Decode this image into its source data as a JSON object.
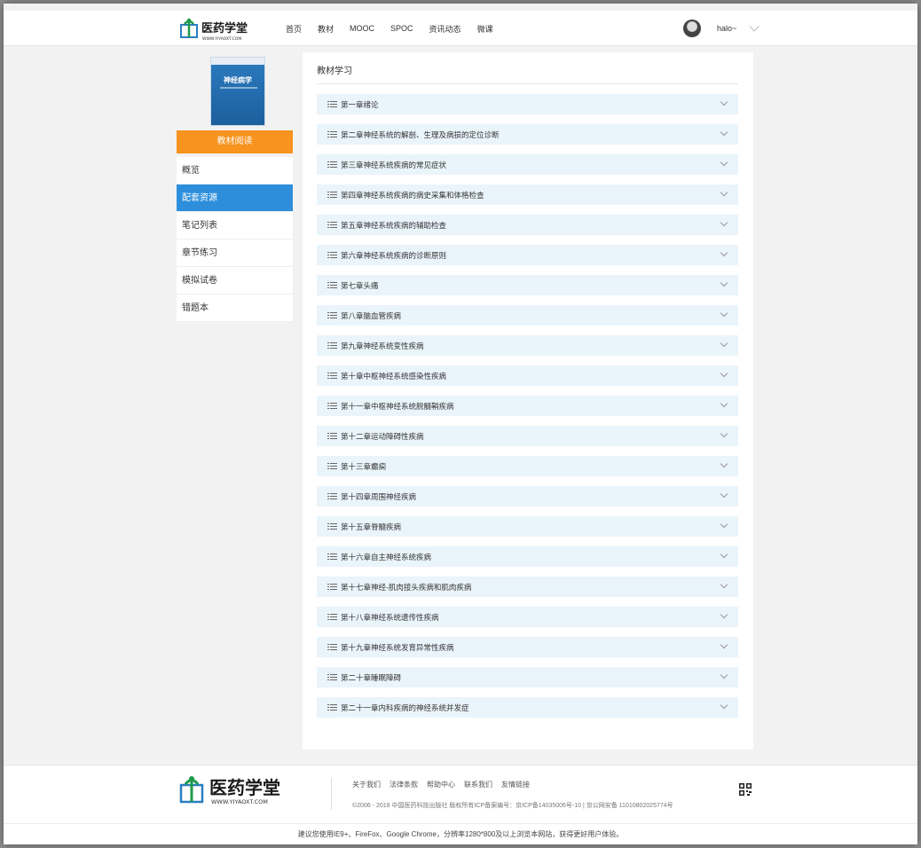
{
  "header": {
    "logo_text": "医药学堂",
    "logo_url_text": "WWW.YIYAOXT.COM",
    "nav": [
      "首页",
      "教材",
      "MOOC",
      "SPOC",
      "资讯动态",
      "微课"
    ],
    "username": "halo~"
  },
  "sidebar": {
    "book_title": "神经病学",
    "read_button": "教材阅读",
    "items": [
      "概览",
      "配套资源",
      "笔记列表",
      "章节练习",
      "模拟试卷",
      "错题本"
    ],
    "active_index": 1
  },
  "main": {
    "title": "教材学习",
    "chapters": [
      "第一章绪论",
      "第二章神经系统的解剖、生理及病损的定位诊断",
      "第三章神经系统疾病的常见症状",
      "第四章神经系统疾病的病史采集和体格检查",
      "第五章神经系统疾病的辅助检查",
      "第六章神经系统疾病的诊断原则",
      "第七章头痛",
      "第八章脑血管疾病",
      "第九章神经系统变性疾病",
      "第十章中枢神经系统感染性疾病",
      "第十一章中枢神经系统脱髓鞘疾病",
      "第十二章运动障碍性疾病",
      "第十三章癫痫",
      "第十四章周围神经疾病",
      "第十五章脊髓疾病",
      "第十六章自主神经系统疾病",
      "第十七章神经-肌肉接头疾病和肌肉疾病",
      "第十八章神经系统遗传性疾病",
      "第十九章神经系统发育异常性疾病",
      "第二十章睡眠障碍",
      "第二十一章内科疾病的神经系统并发症"
    ]
  },
  "footer": {
    "logo_text": "医药学堂",
    "logo_url_text": "WWW.YIYAOXT.COM",
    "links": [
      "关于我们",
      "法律条款",
      "帮助中心",
      "联系我们",
      "友情链接"
    ],
    "copyright": "©2006 - 2018 中国医药科技出版社 版权所有ICP备案编号：京ICP备14035006号-10 | 京公网安备 11010802025774号",
    "notice": "建议您使用IE9+、FireFox、Google Chrome，分辨率1280*800及以上浏览本网站，获得更好用户体验。"
  },
  "colors": {
    "accent_orange": "#f7931e",
    "active_blue": "#2d8fdc",
    "chapter_bg": "#eaf4fb",
    "logo_green": "#1e9a4a"
  }
}
